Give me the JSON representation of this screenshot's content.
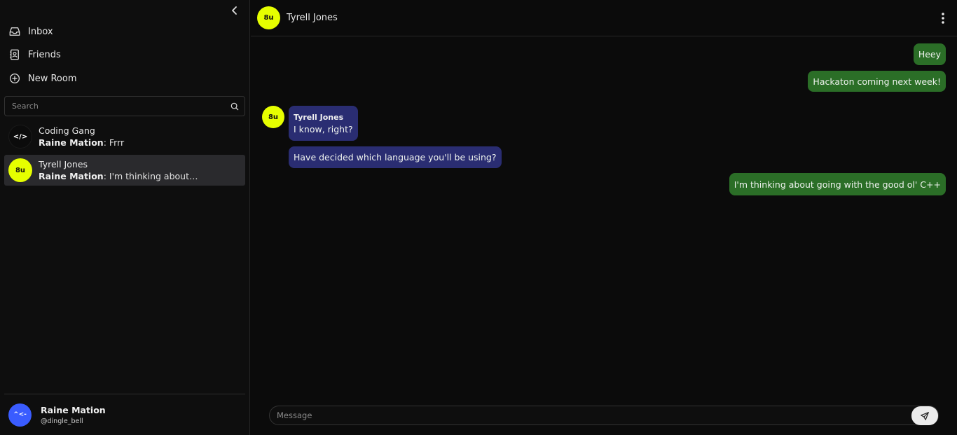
{
  "sidebar": {
    "nav": [
      {
        "label": "Inbox",
        "icon": "inbox-icon"
      },
      {
        "label": "Friends",
        "icon": "contact-book-icon"
      },
      {
        "label": "New Room",
        "icon": "plus-circle-icon"
      }
    ],
    "search": {
      "placeholder": "Search",
      "value": ""
    },
    "rooms": [
      {
        "avatar_text": "</>",
        "name": "Coding Gang",
        "preview_sender": "Raine Mation",
        "preview_text": ": Frrr",
        "avatar_bg": "#0b0b0b",
        "avatar_fg": "#ffffff",
        "active": false
      },
      {
        "avatar_text": "8u",
        "name": "Tyrell Jones",
        "preview_sender": "Raine Mation",
        "preview_text": ": I'm thinking about…",
        "avatar_bg": "#e6ff00",
        "avatar_fg": "#111111",
        "active": true
      }
    ],
    "user": {
      "avatar_text": "^<-",
      "name": "Raine Mation",
      "handle": "@dingle_bell",
      "avatar_bg": "#3a5cff"
    }
  },
  "chat": {
    "header": {
      "avatar_text": "8u",
      "title": "Tyrell Jones",
      "avatar_bg": "#e6ff00"
    },
    "messages": [
      {
        "direction": "out",
        "text": "Heey"
      },
      {
        "direction": "out",
        "text": "Hackaton coming next week!"
      },
      {
        "direction": "in",
        "sender": "Tyrell Jones",
        "avatar_text": "8u",
        "text": "I know, right?"
      },
      {
        "direction": "in",
        "text": "Have decided which language you'll be using?"
      },
      {
        "direction": "out",
        "text": "I'm thinking about going with the good ol' C++"
      }
    ],
    "composer": {
      "placeholder": "Message",
      "value": ""
    }
  },
  "colors": {
    "outgoing_bubble": "#2b6e27",
    "incoming_bubble": "#2a2d72",
    "accent_yellow": "#e6ff00",
    "user_avatar": "#3a5cff"
  }
}
